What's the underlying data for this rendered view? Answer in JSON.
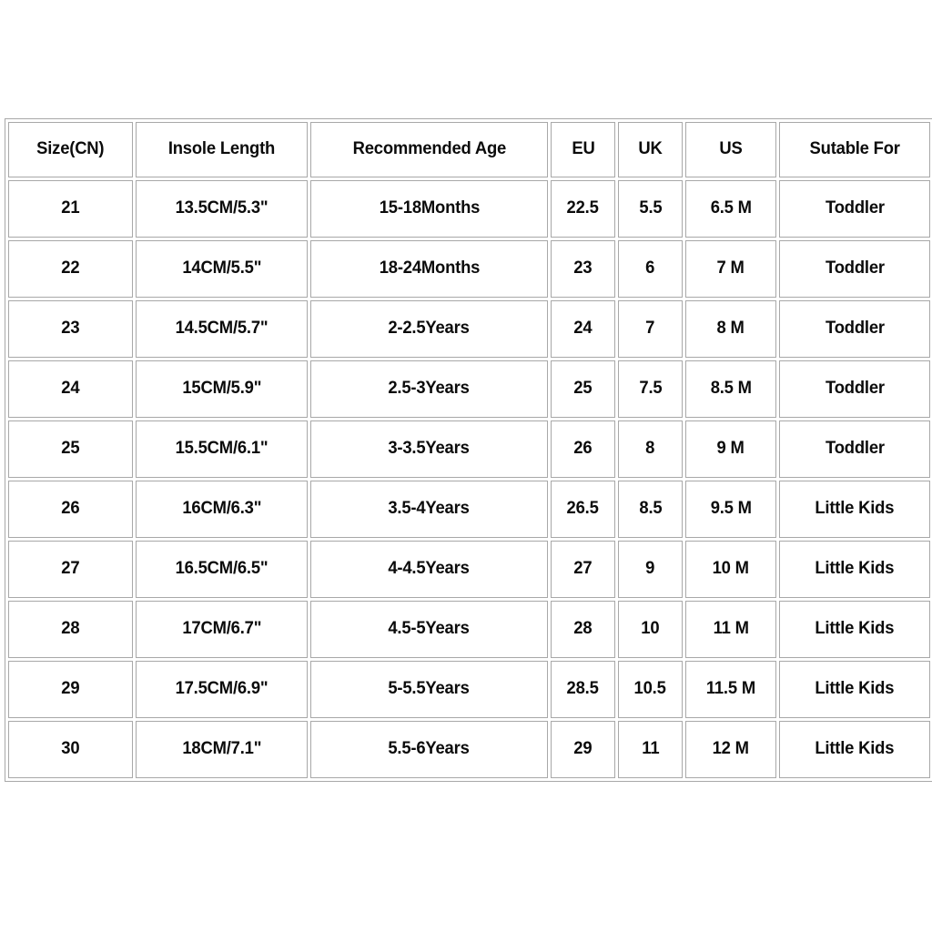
{
  "page": {
    "background_color": "#ffffff",
    "border_color": "#a8a8a8",
    "text_color": "#0b0b0b"
  },
  "table": {
    "name": "shoe-size-chart",
    "columns": [
      "Size(CN)",
      "Insole Length",
      "Recommended Age",
      "EU",
      "UK",
      "US",
      "Sutable For"
    ],
    "rows": [
      {
        "size_cn": "21",
        "insole_length": "13.5CM/5.3\"",
        "recommended_age": "15-18Months",
        "eu": "22.5",
        "uk": "5.5",
        "us": "6.5 M",
        "suitable_for": "Toddler"
      },
      {
        "size_cn": "22",
        "insole_length": "14CM/5.5\"",
        "recommended_age": "18-24Months",
        "eu": "23",
        "uk": "6",
        "us": "7 M",
        "suitable_for": "Toddler"
      },
      {
        "size_cn": "23",
        "insole_length": "14.5CM/5.7\"",
        "recommended_age": "2-2.5Years",
        "eu": "24",
        "uk": "7",
        "us": "8 M",
        "suitable_for": "Toddler"
      },
      {
        "size_cn": "24",
        "insole_length": "15CM/5.9\"",
        "recommended_age": "2.5-3Years",
        "eu": "25",
        "uk": "7.5",
        "us": "8.5 M",
        "suitable_for": "Toddler"
      },
      {
        "size_cn": "25",
        "insole_length": "15.5CM/6.1\"",
        "recommended_age": "3-3.5Years",
        "eu": "26",
        "uk": "8",
        "us": "9 M",
        "suitable_for": "Toddler"
      },
      {
        "size_cn": "26",
        "insole_length": "16CM/6.3\"",
        "recommended_age": "3.5-4Years",
        "eu": "26.5",
        "uk": "8.5",
        "us": "9.5 M",
        "suitable_for": "Little Kids"
      },
      {
        "size_cn": "27",
        "insole_length": "16.5CM/6.5\"",
        "recommended_age": "4-4.5Years",
        "eu": "27",
        "uk": "9",
        "us": "10 M",
        "suitable_for": "Little Kids"
      },
      {
        "size_cn": "28",
        "insole_length": "17CM/6.7\"",
        "recommended_age": "4.5-5Years",
        "eu": "28",
        "uk": "10",
        "us": "11 M",
        "suitable_for": "Little Kids"
      },
      {
        "size_cn": "29",
        "insole_length": "17.5CM/6.9\"",
        "recommended_age": "5-5.5Years",
        "eu": "28.5",
        "uk": "10.5",
        "us": "11.5 M",
        "suitable_for": "Little Kids"
      },
      {
        "size_cn": "30",
        "insole_length": "18CM/7.1\"",
        "recommended_age": "5.5-6Years",
        "eu": "29",
        "uk": "11",
        "us": "12 M",
        "suitable_for": "Little Kids"
      }
    ]
  }
}
